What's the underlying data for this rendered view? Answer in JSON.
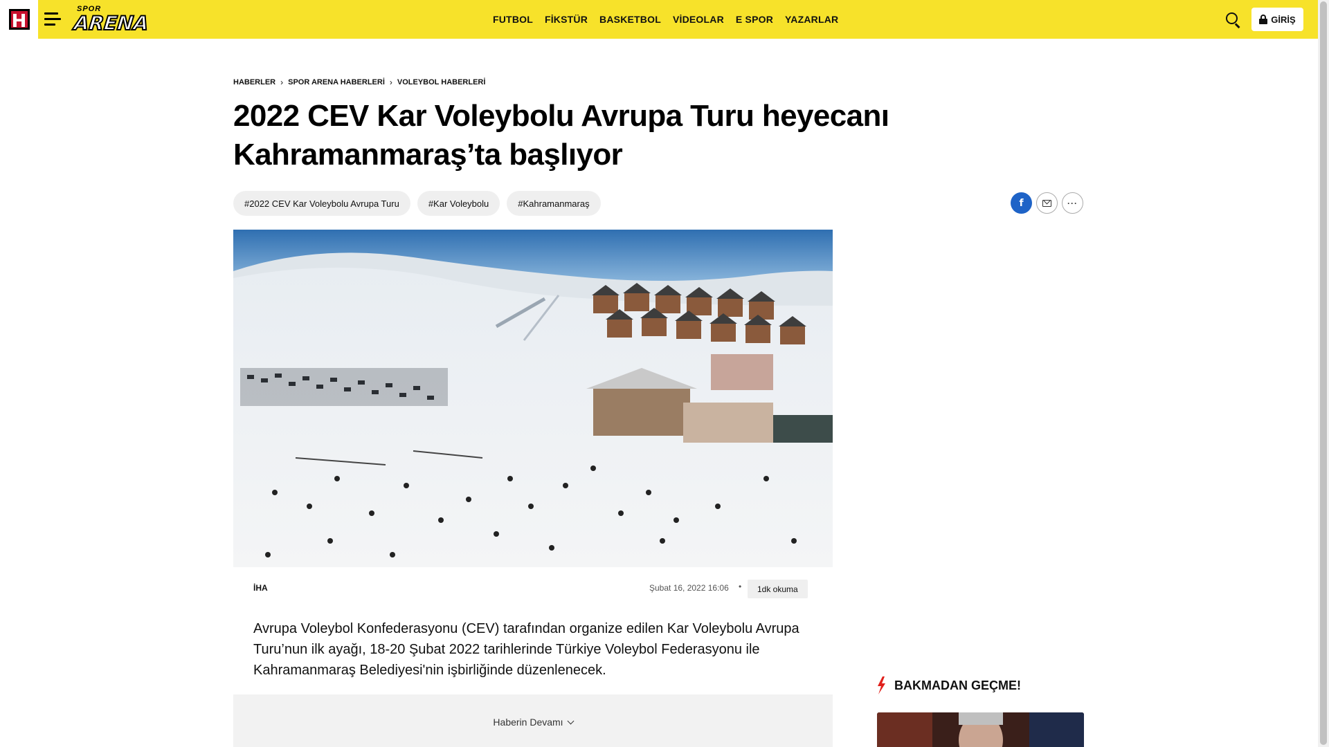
{
  "header": {
    "site_logo_letter": "H",
    "brand_small": "SPOR",
    "brand_big": "ARENA",
    "nav": [
      "FUTBOL",
      "FİKSTÜR",
      "BASKETBOL",
      "VİDEOLAR",
      "E SPOR",
      "YAZARLAR"
    ],
    "login_label": "GİRİŞ"
  },
  "breadcrumb": [
    "HABERLER",
    "SPOR ARENA HABERLERİ",
    "VOLEYBOL HABERLERİ"
  ],
  "article": {
    "title": "2022 CEV Kar Voleybolu Avrupa Turu heyecanı Kahramanmaraş’ta başlıyor",
    "tags": [
      "#2022 CEV Kar Voleybolu Avrupa Turu",
      "#Kar Voleybolu",
      "#Kahramanmaraş"
    ],
    "source": "İHA",
    "date": "Şubat 16, 2022 16:06",
    "dot": "•",
    "read_time": "1dk okuma",
    "lead": "Avrupa Voleybol Konfederasyonu (CEV) tarafından organize edilen Kar Voleybolu Avrupa Turu’nun ilk ayağı, 18-20 Şubat 2022 tarihlerinde Türkiye Voleybol Federasyonu ile Kahramanmaraş Belediyesi'nin işbirliğinde düzenlenecek.",
    "more_label": "Haberin Devamı"
  },
  "share": {
    "facebook_glyph": "f",
    "more_glyph": "···"
  },
  "sidebar": {
    "section_title": "BAKMADAN GEÇME!"
  },
  "colors": {
    "header_bg": "#f7e22a",
    "brand_red": "#c8102e",
    "facebook": "#1e63c7",
    "bolt": "#e0201b"
  }
}
